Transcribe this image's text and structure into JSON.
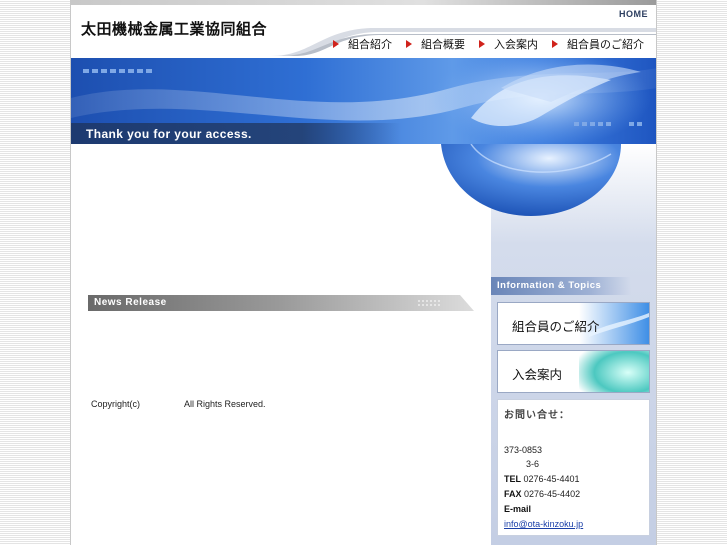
{
  "header": {
    "logo": "太田機械金属工業協同組合",
    "home": "HOME",
    "nav": [
      {
        "label": "組合紹介"
      },
      {
        "label": "組合概要"
      },
      {
        "label": "入会案内"
      },
      {
        "label": "組合員のご紹介"
      }
    ]
  },
  "hero": {
    "tagline": "Thank you for your access."
  },
  "main": {
    "news_title": "News Release",
    "copyright": "Copyright(c)",
    "rights": "All Rights Reserved."
  },
  "sidebar": {
    "info_title": "Information & Topics",
    "buttons": [
      {
        "label": "組合員のご紹介"
      },
      {
        "label": "入会案内"
      }
    ],
    "contact": {
      "title": "お問い合せ：",
      "postal": "373-0853",
      "address": "3-6",
      "tel_label": "TEL",
      "tel": "0276-45-4401",
      "fax_label": "FAX",
      "fax": "0276-45-4402",
      "email_label": "E-mail",
      "email": "info@ota-kinzoku.jp"
    }
  },
  "colors": {
    "accent_blue": "#2f6fd4",
    "nav_arrow_red": "#d0221b",
    "link_blue": "#1a3fa8"
  }
}
